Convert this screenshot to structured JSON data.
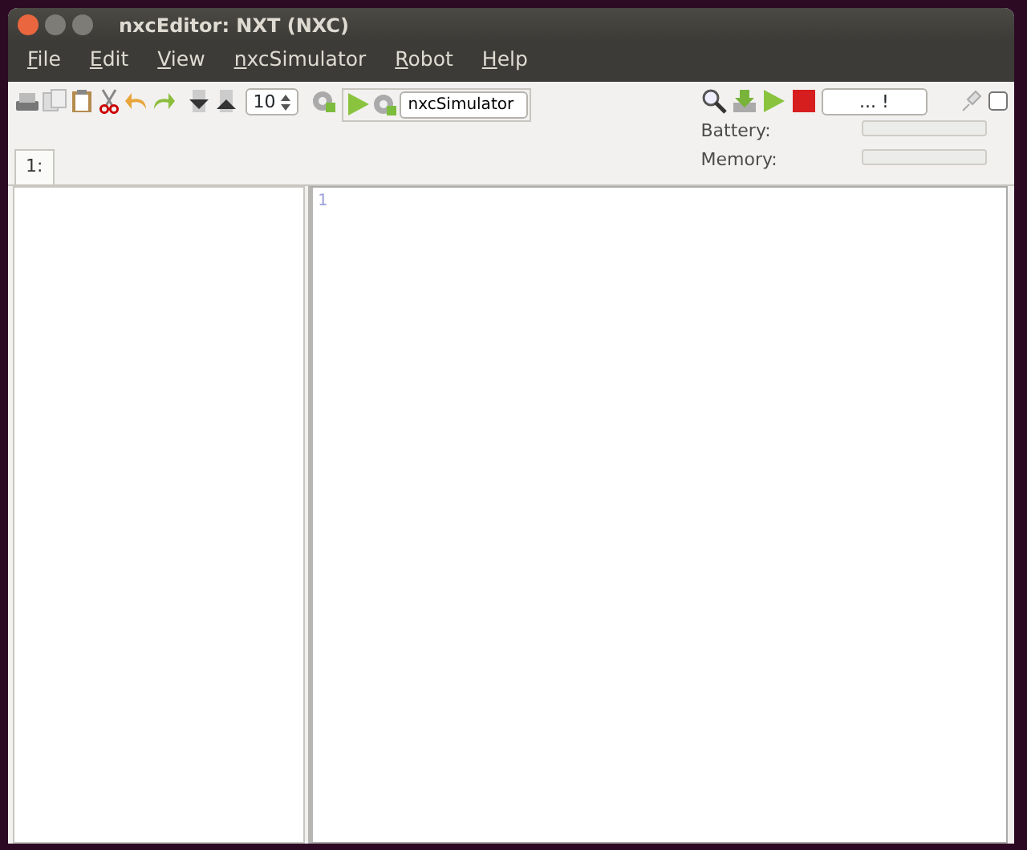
{
  "window": {
    "title": "nxcEditor: NXT (NXC)"
  },
  "menu": [
    "File",
    "Edit",
    "View",
    "nxcSimulator",
    "Robot",
    "Help"
  ],
  "toolbar": {
    "font_size": "10",
    "simulator_field": "nxcSimulator",
    "status_field": "... !",
    "usb_checked": false
  },
  "meters": [
    {
      "label": "Battery:",
      "level": 0
    },
    {
      "label": "Memory:",
      "level": 0
    }
  ],
  "tabs": [
    {
      "label": "1:",
      "selected": true
    }
  ],
  "editor": {
    "line_numbers": [
      "1"
    ]
  }
}
